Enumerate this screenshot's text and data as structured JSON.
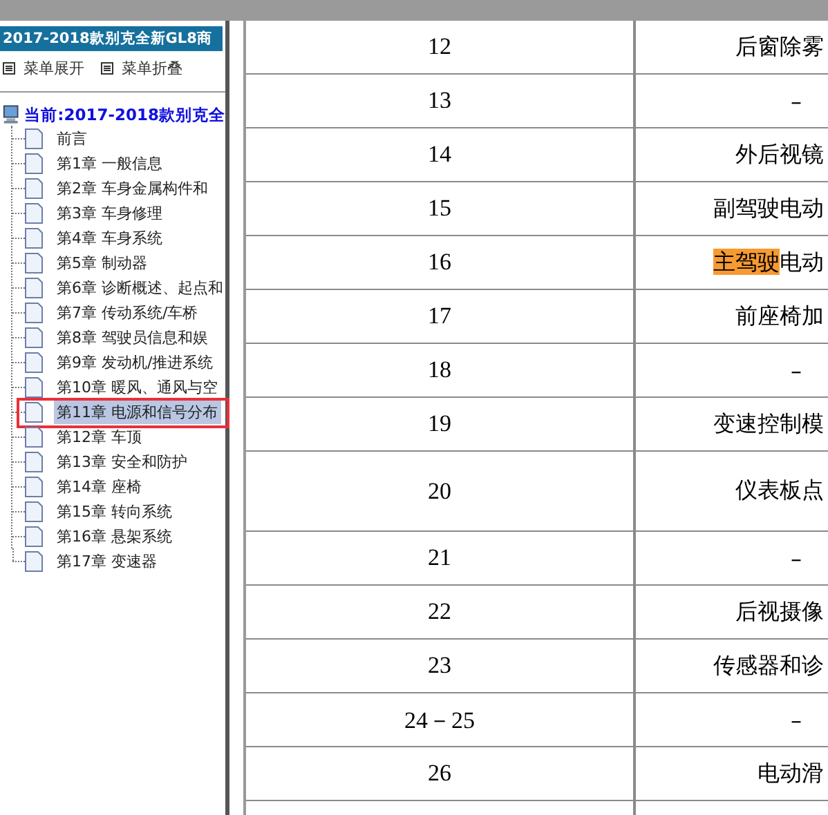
{
  "sidebar": {
    "title": "2017-2018款别克全新GL8商",
    "menu_buttons": [
      "菜单展开",
      "菜单折叠"
    ],
    "tree": {
      "label": "当前:2017-2018款别克全",
      "children": [
        {
          "label": "前言",
          "selected": false
        },
        {
          "label": "第1章 一般信息",
          "selected": false
        },
        {
          "label": "第2章 车身金属构件和",
          "selected": false
        },
        {
          "label": "第3章 车身修理",
          "selected": false
        },
        {
          "label": "第4章 车身系统",
          "selected": false
        },
        {
          "label": "第5章 制动器",
          "selected": false
        },
        {
          "label": "第6章 诊断概述、起点和",
          "selected": false
        },
        {
          "label": "第7章 传动系统/车桥",
          "selected": false
        },
        {
          "label": "第8章 驾驶员信息和娱",
          "selected": false
        },
        {
          "label": "第9章 发动机/推进系统",
          "selected": false
        },
        {
          "label": "第10章 暖风、通风与空",
          "selected": false
        },
        {
          "label": "第11章 电源和信号分布",
          "selected": true
        },
        {
          "label": "第12章 车顶",
          "selected": false
        },
        {
          "label": "第13章 安全和防护",
          "selected": false
        },
        {
          "label": "第14章 座椅",
          "selected": false
        },
        {
          "label": "第15章 转向系统",
          "selected": false
        },
        {
          "label": "第16章 悬架系统",
          "selected": false
        },
        {
          "label": "第17章 变速器",
          "selected": false
        }
      ]
    }
  },
  "table": {
    "rows": [
      {
        "column_1": "12",
        "column_2": [
          {
            "text": "后窗除雾",
            "highlighted": false
          }
        ]
      },
      {
        "column_1": "13",
        "column_2": [
          {
            "text": "–",
            "highlighted": false
          }
        ]
      },
      {
        "column_1": "14",
        "column_2": [
          {
            "text": "外后视镜",
            "highlighted": false
          }
        ]
      },
      {
        "column_1": "15",
        "column_2": [
          {
            "text": "副驾驶电动",
            "highlighted": false
          }
        ]
      },
      {
        "column_1": "16",
        "column_2": [
          {
            "text": "主驾驶",
            "highlighted": true
          },
          {
            "text": "电动",
            "highlighted": false
          }
        ]
      },
      {
        "column_1": "17",
        "column_2": [
          {
            "text": "前座椅加",
            "highlighted": false
          }
        ]
      },
      {
        "column_1": "18",
        "column_2": [
          {
            "text": "–",
            "highlighted": false
          }
        ]
      },
      {
        "column_1": "19",
        "column_2": [
          {
            "text": "变速控制模",
            "highlighted": false
          }
        ]
      },
      {
        "column_1": "20",
        "column_2": [
          {
            "text": "仪表板点",
            "highlighted": false
          }
        ],
        "tall": true
      },
      {
        "column_1": "21",
        "column_2": [
          {
            "text": "–",
            "highlighted": false
          }
        ]
      },
      {
        "column_1": "22",
        "column_2": [
          {
            "text": "后视摄像",
            "highlighted": false
          }
        ]
      },
      {
        "column_1": "23",
        "column_2": [
          {
            "text": "传感器和诊",
            "highlighted": false
          }
        ]
      },
      {
        "column_1": "24－25",
        "column_2": [
          {
            "text": "–",
            "highlighted": false
          }
        ]
      },
      {
        "column_1": "26",
        "column_2": [
          {
            "text": "电动滑",
            "highlighted": false
          }
        ]
      }
    ]
  }
}
